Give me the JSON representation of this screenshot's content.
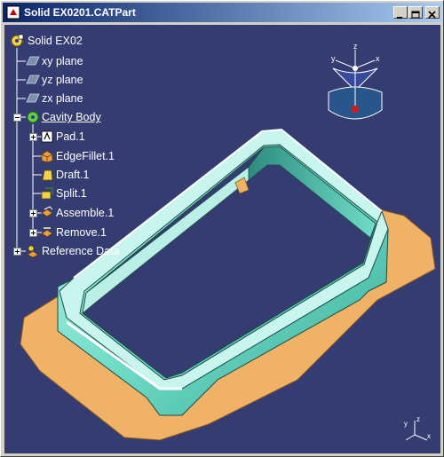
{
  "window": {
    "title": "Solid EX0201.CATPart"
  },
  "tree": {
    "root": "Solid EX02",
    "planes": [
      "xy plane",
      "yz plane",
      "zx plane"
    ],
    "body": "Cavity Body",
    "features": [
      "Pad.1",
      "EdgeFillet.1",
      "Draft.1",
      "Split.1",
      "Assemble.1",
      "Remove.1"
    ],
    "reference": "Reference Data"
  },
  "compass": {
    "x_label": "x",
    "y_label": "y",
    "z_label": "z"
  },
  "axis_triad": {
    "x_label": "x",
    "y_label": "y",
    "z_label": "z"
  },
  "colors": {
    "titlebar_start": "#0a246a",
    "titlebar_end": "#a6caf0",
    "background": "#353c72",
    "part_body": "#6fdcc8",
    "part_flange": "#efb267",
    "tree_text": "#ffffff"
  },
  "icons": {
    "title": "catia-part-icon",
    "root": "part-gear-icon",
    "plane": "plane-icon",
    "body": "body-gear-icon",
    "pad": "pad-icon",
    "fillet": "fillet-icon",
    "draft": "draft-icon",
    "split": "split-icon",
    "assemble": "assemble-icon",
    "remove": "remove-icon",
    "reference": "reference-data-icon"
  }
}
